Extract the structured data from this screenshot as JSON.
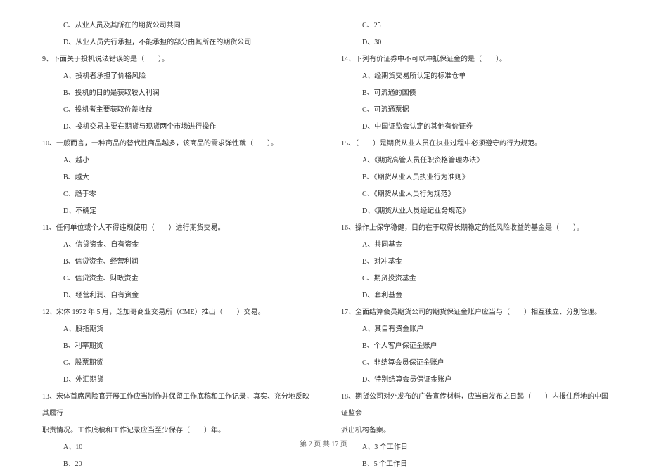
{
  "left": {
    "pre_options": [
      "C、从业人员及其所在的期货公司共同",
      "D、从业人员先行承担，不能承担的部分由其所在的期货公司"
    ],
    "items": [
      {
        "q": "9、下面关于投机说法错误的是（　　）。",
        "opts": [
          "A、投机者承担了价格风险",
          "B、投机的目的是获取较大利润",
          "C、投机者主要获取价差收益",
          "D、投机交易主要在期货与现货两个市场进行操作"
        ]
      },
      {
        "q": "10、一般而言，一种商品的替代性商品越多，该商品的需求弹性就（　　）。",
        "opts": [
          "A、越小",
          "B、越大",
          "C、趋于零",
          "D、不确定"
        ]
      },
      {
        "q": "11、任何单位或个人不得违规使用（　　）进行期货交易。",
        "opts": [
          "A、信贷资金、自有资金",
          "B、信贷资金、经营利润",
          "C、信贷资金、财政资金",
          "D、经营利润、自有资金"
        ]
      },
      {
        "q": "12、宋体 1972 年 5 月，芝加哥商业交易所（CME）推出（　　）交易。",
        "opts": [
          "A、股指期货",
          "B、利率期货",
          "C、股票期货",
          "D、外汇期货"
        ]
      },
      {
        "q": "13、宋体首席风险官开展工作应当制作并保留工作底稿和工作记录，真实、充分地反映其履行",
        "q2": "职责情况。工作底稿和工作记录应当至少保存（　　）年。",
        "opts": [
          "A、10",
          "B、20"
        ]
      }
    ]
  },
  "right": {
    "pre_options": [
      "C、25",
      "D、30"
    ],
    "items": [
      {
        "q": "14、下列有价证券中不可以冲抵保证金的是（　　）。",
        "opts": [
          "A、经期货交易所认定的标准仓单",
          "B、可流通的国债",
          "C、可流通票据",
          "D、中国证监会认定的其他有价证券"
        ]
      },
      {
        "q": "15、（　　）是期货从业人员在执业过程中必须遵守的行为规范。",
        "opts": [
          "A、《期货高管人员任职资格管理办法》",
          "B、《期货从业人员执业行为准则》",
          "C、《期货从业人员行为规范》",
          "D、《期货从业人员经纪业务规范》"
        ]
      },
      {
        "q": "16、操作上保守稳健，目的在于取得长期稳定的低风险收益的基金是（　　）。",
        "opts": [
          "A、共同基金",
          "B、对冲基金",
          "C、期货投资基金",
          "D、套利基金"
        ]
      },
      {
        "q": "17、全面结算会员期货公司的期货保证金账户应当与（　　）相互独立、分别管理。",
        "opts": [
          "A、其自有资金账户",
          "B、个人客户保证金账户",
          "C、非结算会员保证金账户",
          "D、特别结算会员保证金账户"
        ]
      },
      {
        "q": "18、期货公司对外发布的广告宣传材料，应当自发布之日起（　　）内报住所地的中国证监会",
        "q2": "派出机构备案。",
        "opts": [
          "A、3 个工作日",
          "B、5 个工作日"
        ]
      }
    ]
  },
  "footer": "第 2 页 共 17 页"
}
